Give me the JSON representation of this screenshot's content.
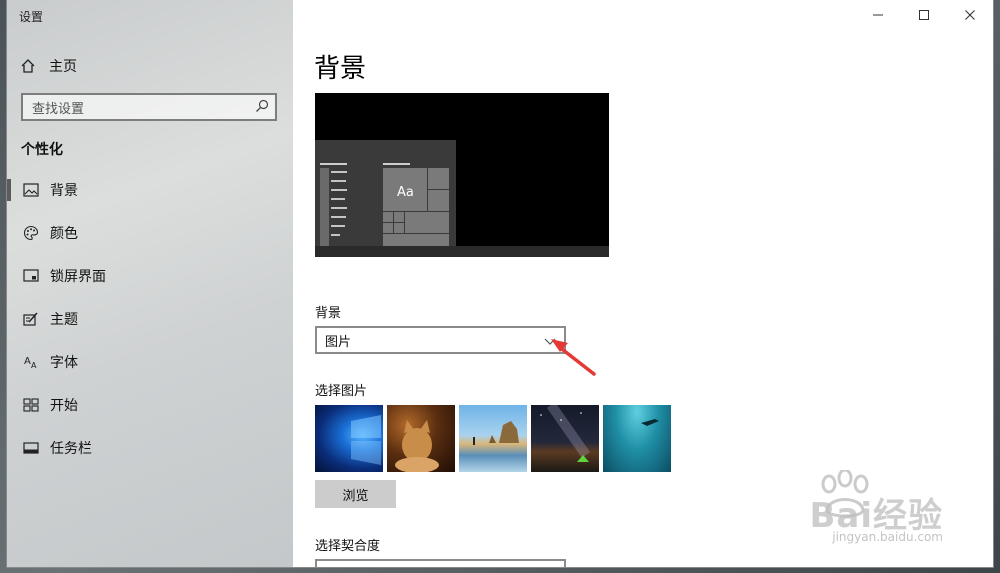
{
  "window": {
    "app_title": "设置",
    "controls": [
      "minimize-icon",
      "maximize-icon",
      "close-icon"
    ]
  },
  "sidebar": {
    "home_label": "主页",
    "search_placeholder": "查找设置",
    "section_title": "个性化",
    "items": [
      {
        "label": "背景",
        "icon": "image-icon",
        "active": true
      },
      {
        "label": "颜色",
        "icon": "palette-icon",
        "active": false
      },
      {
        "label": "锁屏界面",
        "icon": "lock-screen-icon",
        "active": false
      },
      {
        "label": "主题",
        "icon": "theme-icon",
        "active": false
      },
      {
        "label": "字体",
        "icon": "font-icon",
        "active": false
      },
      {
        "label": "开始",
        "icon": "start-icon",
        "active": false
      },
      {
        "label": "任务栏",
        "icon": "taskbar-icon",
        "active": false
      }
    ]
  },
  "main": {
    "page_title": "背景",
    "preview_sample_text": "Aa",
    "background_label": "背景",
    "background_value": "图片",
    "choose_picture_label": "选择图片",
    "thumbnails": [
      "windows-logo-wallpaper",
      "cat-wallpaper",
      "beach-rocks-wallpaper",
      "night-sky-tent-wallpaper",
      "underwater-swimmer-wallpaper"
    ],
    "browse_label": "浏览",
    "fit_label": "选择契合度"
  },
  "watermark": {
    "text": "Bai经验",
    "subtext": "jingyan.baidu.com"
  },
  "colors": {
    "sidebar_bg": "#d4d6d7",
    "annotation_arrow": "#e53935",
    "accent_bar": "#5b5b5b"
  }
}
